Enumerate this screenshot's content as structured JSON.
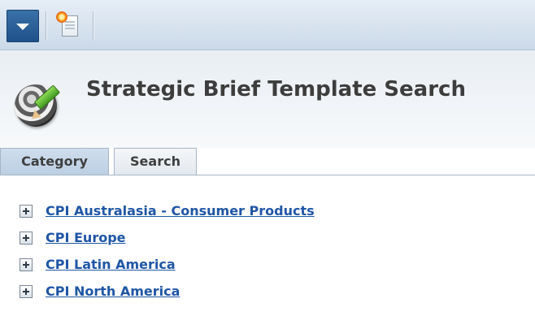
{
  "toolbar": {
    "menu_icon": "dropdown-caret-icon",
    "new_icon": "new-document-icon",
    "accent_color": "#1f5089"
  },
  "header": {
    "app_icon": "strategic-brief-icon",
    "title": "Strategic Brief Template Search"
  },
  "tabs": [
    {
      "label": "Category",
      "active": true
    },
    {
      "label": "Search",
      "active": false
    }
  ],
  "tree": {
    "expander_icon": "plus-expander-icon",
    "link_color": "#1f56a5",
    "items": [
      {
        "label": "CPI Australasia - Consumer Products"
      },
      {
        "label": "CPI Europe"
      },
      {
        "label": "CPI Latin America"
      },
      {
        "label": "CPI North America"
      }
    ]
  }
}
